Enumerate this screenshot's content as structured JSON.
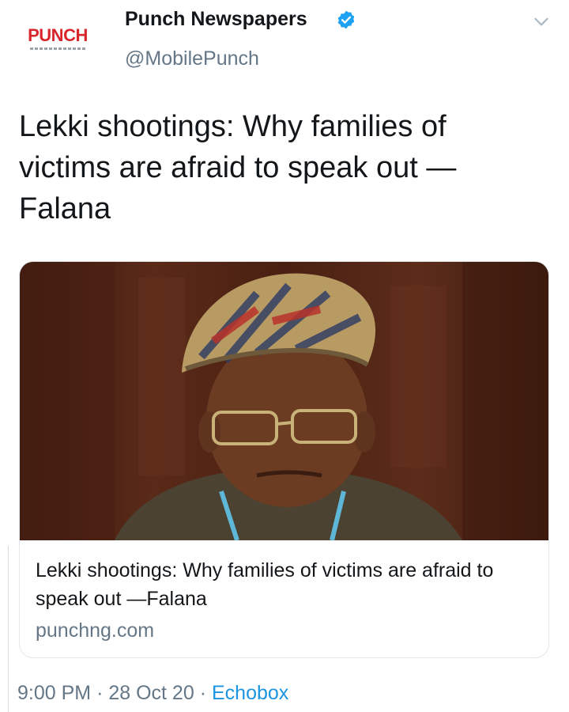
{
  "account": {
    "avatar_logo": "PUNCH",
    "display_name": "Punch Newspapers",
    "handle": "@MobilePunch",
    "verified": true
  },
  "tweet": {
    "text": "Lekki shootings: Why families of victims are afraid to speak out —Falana"
  },
  "card": {
    "title": "Lekki shootings: Why families of victims are afraid to speak out —Falana",
    "domain": "punchng.com"
  },
  "meta": {
    "time": "9:00 PM",
    "separator": "·",
    "date": "28 Oct 20",
    "source": "Echobox"
  },
  "colors": {
    "verified_badge": "#1da1f2",
    "link": "#1b95e0",
    "secondary_text": "#657786",
    "logo_red": "#d7262c"
  },
  "icons": {
    "verified": "verified-badge-icon",
    "menu": "chevron-down-icon"
  }
}
